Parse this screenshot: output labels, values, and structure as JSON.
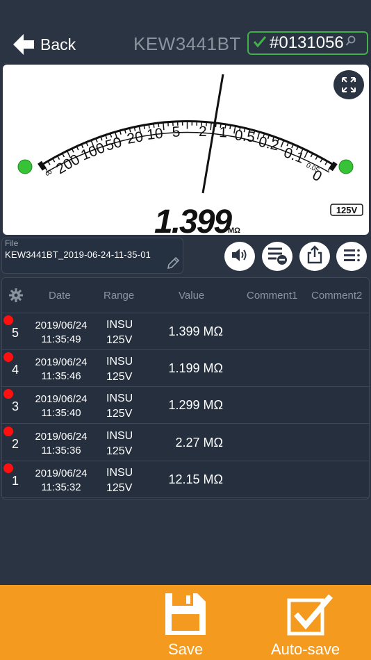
{
  "header": {
    "back_label": "Back",
    "model": "KEW3441BT",
    "serial": "#0131056"
  },
  "meter": {
    "scale_labels": [
      "∞",
      "200",
      "100",
      "50",
      "20",
      "10",
      "5",
      "2",
      "1",
      "0.5",
      "0.2",
      "0.1",
      "0.05",
      "0"
    ],
    "reading_digits": "1.399",
    "reading_unit": "MΩ",
    "range_badge": "125V",
    "left_indicator": "green",
    "right_indicator": "green"
  },
  "file": {
    "label": "File",
    "name": "KEW3441BT_2019-06-24-11-35-01"
  },
  "table": {
    "headers": [
      "Date",
      "Range",
      "Value",
      "Comment1",
      "Comment2"
    ],
    "rows": [
      {
        "num": "5",
        "date": "2019/06/24",
        "time": "11:35:49",
        "func": "INSU",
        "range": "125V",
        "value": "1.399 MΩ"
      },
      {
        "num": "4",
        "date": "2019/06/24",
        "time": "11:35:46",
        "func": "INSU",
        "range": "125V",
        "value": "1.199 MΩ"
      },
      {
        "num": "3",
        "date": "2019/06/24",
        "time": "11:35:40",
        "func": "INSU",
        "range": "125V",
        "value": "1.299 MΩ"
      },
      {
        "num": "2",
        "date": "2019/06/24",
        "time": "11:35:36",
        "func": "INSU",
        "range": "125V",
        "value": "2.27 MΩ"
      },
      {
        "num": "1",
        "date": "2019/06/24",
        "time": "11:35:32",
        "func": "INSU",
        "range": "125V",
        "value": "12.15 MΩ"
      }
    ]
  },
  "footer": {
    "save_label": "Save",
    "autosave_label": "Auto-save"
  },
  "colors": {
    "background": "#2b3442",
    "accent_orange": "#f39a1f",
    "status_green": "#43b04a",
    "marker_red": "#ff1010"
  },
  "icons": [
    "back-arrow-icon",
    "check-icon",
    "search-icon",
    "expand-icon",
    "pencil-icon",
    "speaker-icon",
    "list-remove-icon",
    "share-icon",
    "menu-icon",
    "gear-icon",
    "save-icon",
    "checkbox-icon"
  ]
}
